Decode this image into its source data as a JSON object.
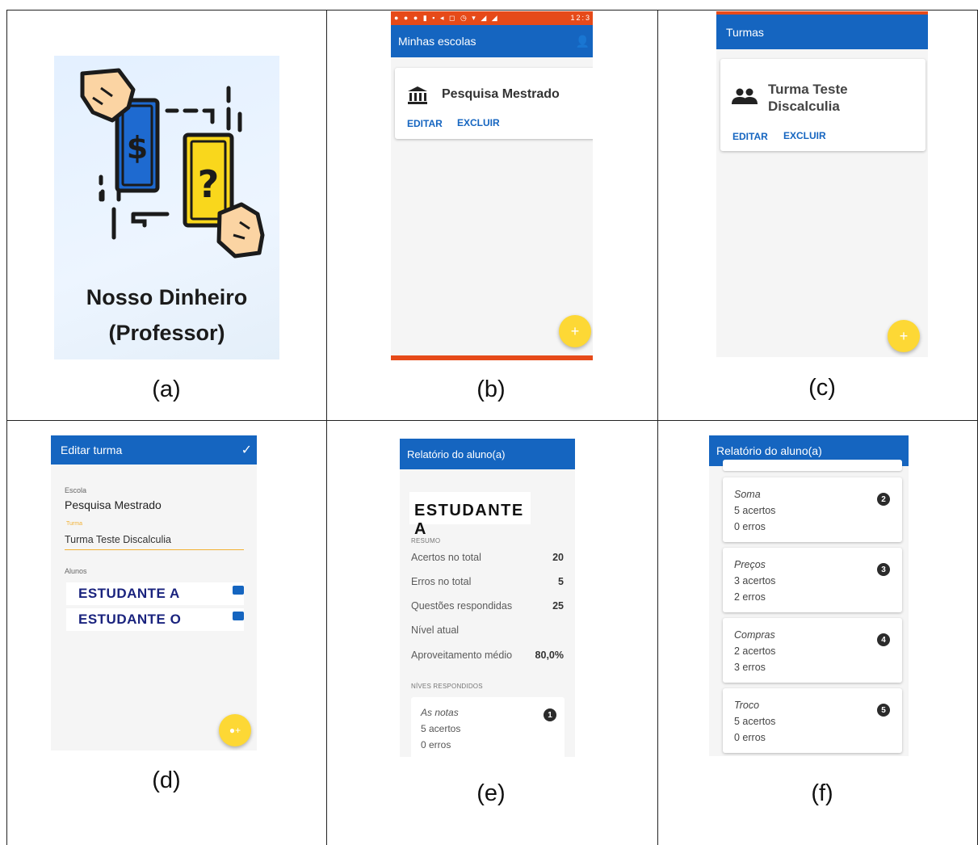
{
  "captions": [
    "(a)",
    "(b)",
    "(c)",
    "(d)",
    "(e)",
    "(f)"
  ],
  "panel_a": {
    "title_line1": "Nosso Dinheiro",
    "title_line2": "(Professor)",
    "colors": {
      "blue_note": "#1e6ad0",
      "yellow_note": "#f9d71c",
      "hand": "#fbd4a3"
    }
  },
  "panel_b": {
    "status_time": "12:3",
    "appbar_title": "Minhas escolas",
    "school_name": "Pesquisa Mestrado",
    "edit_label": "EDITAR",
    "delete_label": "EXCLUIR",
    "fab_label": "+"
  },
  "panel_c": {
    "appbar_title": "Turmas",
    "class_name_line1": "Turma Teste",
    "class_name_line2": "Discalculia",
    "edit_label": "EDITAR",
    "delete_label": "EXCLUIR",
    "fab_label": "+"
  },
  "panel_d": {
    "appbar_title": "Editar turma",
    "school_label": "Escola",
    "school_value": "Pesquisa Mestrado",
    "class_label": "Turma",
    "class_value": "Turma Teste Discalculia",
    "students_label": "Alunos",
    "students": [
      "ESTUDANTE A",
      "ESTUDANTE O"
    ]
  },
  "panel_e": {
    "appbar_title": "Relatório do aluno(a)",
    "student_name": "ESTUDANTE A",
    "summary_label": "RESUMO",
    "rows": [
      {
        "label": "Acertos no total",
        "value": "20"
      },
      {
        "label": "Erros no total",
        "value": "5"
      },
      {
        "label": "Questões respondidas",
        "value": "25"
      },
      {
        "label": "Nível atual",
        "value": ""
      },
      {
        "label": "Aproveitamento médio",
        "value": "80,0%"
      }
    ],
    "levels_label": "NÍVES RESPONDIDOS",
    "level": {
      "name": "As notas",
      "correct": "5 acertos",
      "errors": "0 erros",
      "badge": "1"
    }
  },
  "panel_f": {
    "appbar_title": "Relatório do aluno(a)",
    "levels": [
      {
        "name": "Soma",
        "correct": "5 acertos",
        "errors": "0 erros",
        "badge": "2"
      },
      {
        "name": "Preços",
        "correct": "3 acertos",
        "errors": "2 erros",
        "badge": "3"
      },
      {
        "name": "Compras",
        "correct": "2 acertos",
        "errors": "3 erros",
        "badge": "4"
      },
      {
        "name": "Troco",
        "correct": "5 acertos",
        "errors": "0 erros",
        "badge": "5"
      }
    ]
  },
  "theme": {
    "primary": "#1565c0",
    "accent": "#fdd835",
    "status_bar": "#e64a19"
  }
}
